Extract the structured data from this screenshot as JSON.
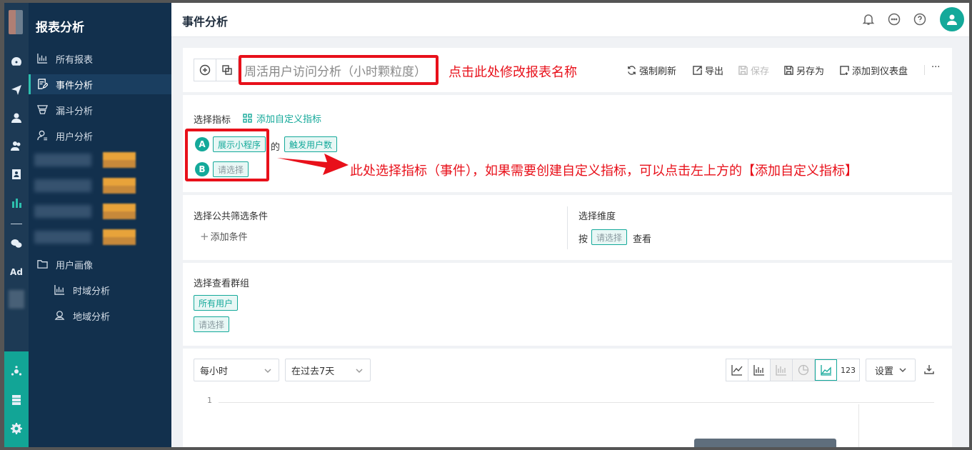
{
  "sidebar": {
    "title": "报表分析",
    "items": [
      {
        "label": "所有报表",
        "icon": "bar-chart-icon"
      },
      {
        "label": "事件分析",
        "icon": "edit-report-icon",
        "active": true
      },
      {
        "label": "漏斗分析",
        "icon": "funnel-icon"
      },
      {
        "label": "用户分析",
        "icon": "user-icon"
      }
    ],
    "portrait": {
      "label": "用户画像",
      "icon": "folder-icon"
    },
    "sub_items": [
      {
        "label": "时域分析",
        "icon": "bar-chart-icon"
      },
      {
        "label": "地域分析",
        "icon": "location-icon"
      }
    ]
  },
  "rail": {
    "ad_label": "Ad"
  },
  "header": {
    "title": "事件分析"
  },
  "toolbar": {
    "report_name": "周活用户访问分析（小时颗粒度）",
    "annotation": "点击此处修改报表名称",
    "actions": {
      "refresh": "强制刷新",
      "export": "导出",
      "save": "保存",
      "save_as": "另存为",
      "add_dashboard": "添加到仪表盘"
    },
    "more": "···"
  },
  "metrics": {
    "label": "选择指标",
    "add_custom": "添加自定义指标",
    "a_letter": "A",
    "a_event": "展示小程序",
    "of": "的",
    "a_measure": "触发用户数",
    "b_letter": "B",
    "b_placeholder": "请选择",
    "annotation": "此处选择指标（事件），如果需要创建自定义指标，可以点击左上方的【添加自定义指标】"
  },
  "filters": {
    "label": "选择公共筛选条件",
    "add": "添加条件",
    "dim_label": "选择维度",
    "by": "按",
    "dim_placeholder": "请选择",
    "view": "查看"
  },
  "groups": {
    "label": "选择查看群组",
    "all_users": "所有用户",
    "placeholder": "请选择"
  },
  "chart": {
    "granularity": "每小时",
    "range": "在过去7天",
    "number_view": "123",
    "settings": "设置",
    "ytick": "1"
  },
  "colors": {
    "accent": "#14a99a",
    "annotation": "#e8101a",
    "sidebar": "#12304d"
  }
}
